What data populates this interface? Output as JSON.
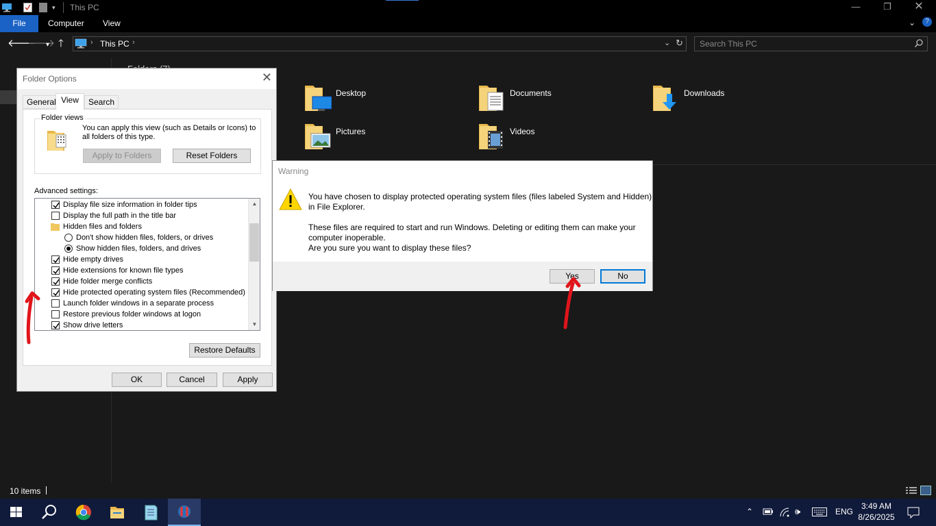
{
  "window": {
    "title": "This PC"
  },
  "ribbon": {
    "tabs": [
      "File",
      "Computer",
      "View"
    ]
  },
  "address": {
    "path": "This PC",
    "search_placeholder": "Search This PC"
  },
  "content": {
    "group_header": "Folders (7)",
    "folders": [
      {
        "name": "Desktop",
        "icon": "desktop-folder-icon"
      },
      {
        "name": "Documents",
        "icon": "documents-folder-icon"
      },
      {
        "name": "Downloads",
        "icon": "downloads-folder-icon"
      },
      {
        "name": "Pictures",
        "icon": "pictures-folder-icon"
      },
      {
        "name": "Videos",
        "icon": "videos-folder-icon"
      }
    ]
  },
  "status": {
    "items": "10 items"
  },
  "taskbar": {
    "language": "ENG",
    "time": "3:49 AM",
    "date": "8/26/2025"
  },
  "folder_options": {
    "title": "Folder Options",
    "tabs": [
      "General",
      "View",
      "Search"
    ],
    "selected_tab": "View",
    "folder_views_legend": "Folder views",
    "folder_views_text": "You can apply this view (such as Details or Icons) to all folders of this type.",
    "apply_to_folders": "Apply to Folders",
    "reset_folders": "Reset Folders",
    "advanced_label": "Advanced settings:",
    "settings": [
      {
        "type": "check",
        "checked": true,
        "label": "Display file size information in folder tips"
      },
      {
        "type": "check",
        "checked": false,
        "label": "Display the full path in the title bar"
      },
      {
        "type": "folder",
        "label": "Hidden files and folders"
      },
      {
        "type": "radio",
        "checked": false,
        "label": "Don't show hidden files, folders, or drives"
      },
      {
        "type": "radio",
        "checked": true,
        "label": "Show hidden files, folders, and drives"
      },
      {
        "type": "check",
        "checked": true,
        "label": "Hide empty drives"
      },
      {
        "type": "check",
        "checked": true,
        "label": "Hide extensions for known file types"
      },
      {
        "type": "check",
        "checked": true,
        "label": "Hide folder merge conflicts"
      },
      {
        "type": "check",
        "checked": true,
        "label": "Hide protected operating system files (Recommended)"
      },
      {
        "type": "check",
        "checked": false,
        "label": "Launch folder windows in a separate process"
      },
      {
        "type": "check",
        "checked": false,
        "label": "Restore previous folder windows at logon"
      },
      {
        "type": "check",
        "checked": true,
        "label": "Show drive letters"
      }
    ],
    "restore_defaults": "Restore Defaults",
    "ok": "OK",
    "cancel": "Cancel",
    "apply": "Apply"
  },
  "warning": {
    "title": "Warning",
    "line1": "You have chosen to display protected operating system files (files labeled System and Hidden)",
    "line2": "in File Explorer.",
    "line3": "These files are required to start and run Windows. Deleting or editing them can make your",
    "line4": "computer inoperable.",
    "line5": "Are you sure you want to display these files?",
    "yes": "Yes",
    "no": "No"
  },
  "colors": {
    "file_tab": "#1a62c4",
    "taskbar": "#101a3a",
    "annotation_arrow": "#e0151b",
    "default_button_border": "#0078d7"
  }
}
